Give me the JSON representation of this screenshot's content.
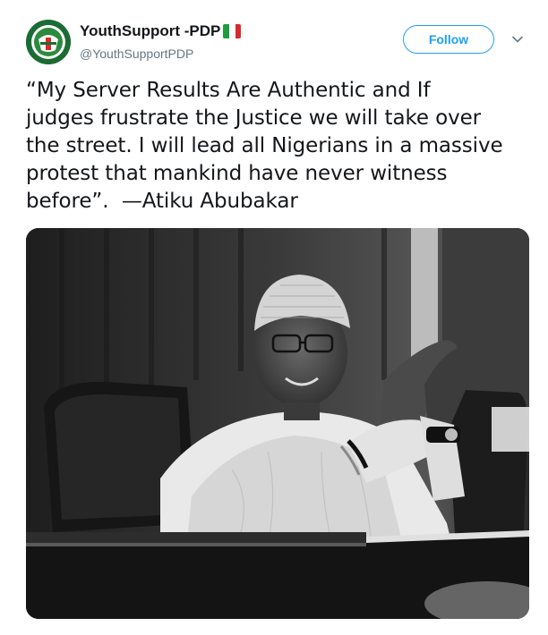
{
  "account": {
    "display_name": "YouthSupport -PDP",
    "handle": "@YouthSupportPDP",
    "avatar_icon": "pdp-logo-icon",
    "flag_icon": "nigeria-flag-icon"
  },
  "actions": {
    "follow_label": "Follow",
    "more_icon": "chevron-down-icon"
  },
  "tweet": {
    "text": "“My Server Results Are Authentic and If\njudges frustrate the Justice we will take over\nthe street. I will lead all Nigerians in a massive\nprotest that mankind have never witness\nbefore”.  —Atiku Abubakar"
  },
  "colors": {
    "accent": "#1da1f2",
    "muted": "#657786",
    "text": "#14171a",
    "flag_green": "#1e9e3e",
    "flag_white": "#ffffff",
    "flag_red": "#d62b2b"
  }
}
